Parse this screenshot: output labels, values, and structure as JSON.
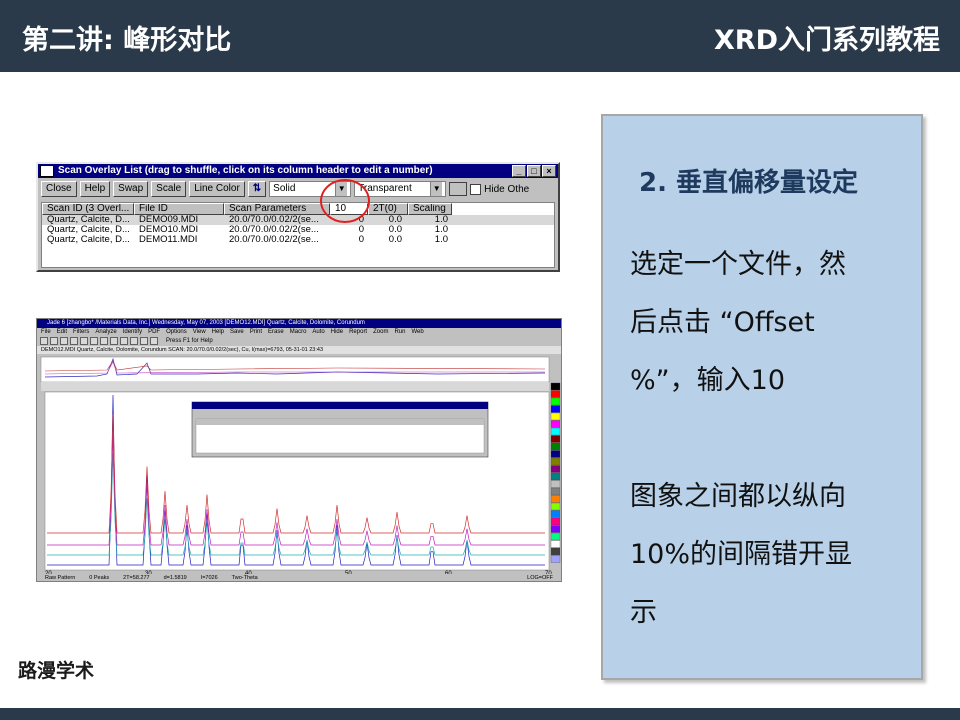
{
  "header": {
    "title": "第二讲: 峰形对比",
    "series": "XRD入门系列教程"
  },
  "footer": {
    "brand": "路漫学术"
  },
  "panel": {
    "heading": "2. 垂直偏移量设定",
    "lines": [
      "选定一个文件，然",
      "后点击 “Offset",
      "%”，输入10",
      "图象之间都以纵向",
      "10%的间隔错开显",
      "示"
    ]
  },
  "dialog": {
    "title": "Scan Overlay List (drag to shuffle, click on its column header to edit a number)",
    "buttons": [
      "Close",
      "Help",
      "Swap",
      "Scale",
      "Line Color"
    ],
    "line_style": "Solid",
    "fill": "Transparent",
    "hide_label": "Hide Othe",
    "columns": [
      "Scan ID (3 Overl...",
      "File ID",
      "Scan Parameters",
      "10",
      "2T(0)",
      "Scaling"
    ],
    "rows": [
      [
        "Quartz, Calcite, D...",
        "DEMO09.MDI",
        "20.0/70.0/0.02/2(se...",
        "0",
        "0.0",
        "1.0"
      ],
      [
        "Quartz, Calcite, D...",
        "DEMO10.MDI",
        "20.0/70.0/0.02/2(se...",
        "0",
        "0.0",
        "1.0"
      ],
      [
        "Quartz, Calcite, D...",
        "DEMO11.MDI",
        "20.0/70.0/0.02/2(se...",
        "0",
        "0.0",
        "1.0"
      ]
    ]
  },
  "jade": {
    "title": "Jade 6 [zhangbo* /Materials Data, Inc.] Wednesday, May 07, 2003 [DEMO12.MDI] Quartz, Calcite, Dolomite, Corundum",
    "menu": [
      "File",
      "Edit",
      "Filters",
      "Analyze",
      "Identify",
      "PDF",
      "Options",
      "View",
      "Help",
      "Save",
      "Print",
      "Erase",
      "Macro",
      "Auto",
      "Hide",
      "Report",
      "Zoom",
      "Run",
      "Web"
    ],
    "help_text": "Press F1 for Help",
    "scan_info": "DEMO12.MDI   Quartz, Calcite, Dolomite, Corundum    SCAN: 20.0/70.0/0.02/2(sec), Cu, I(max)=6793, 05-31-01 23:43",
    "status": [
      "Raw Pattern",
      "0 Peaks",
      "2T=58.277",
      "d=1.5819",
      "I=7026",
      "Two-Theta",
      "LOG=OFF"
    ],
    "x_ticks": [
      "20",
      "30",
      "40",
      "50",
      "60",
      "70"
    ]
  }
}
